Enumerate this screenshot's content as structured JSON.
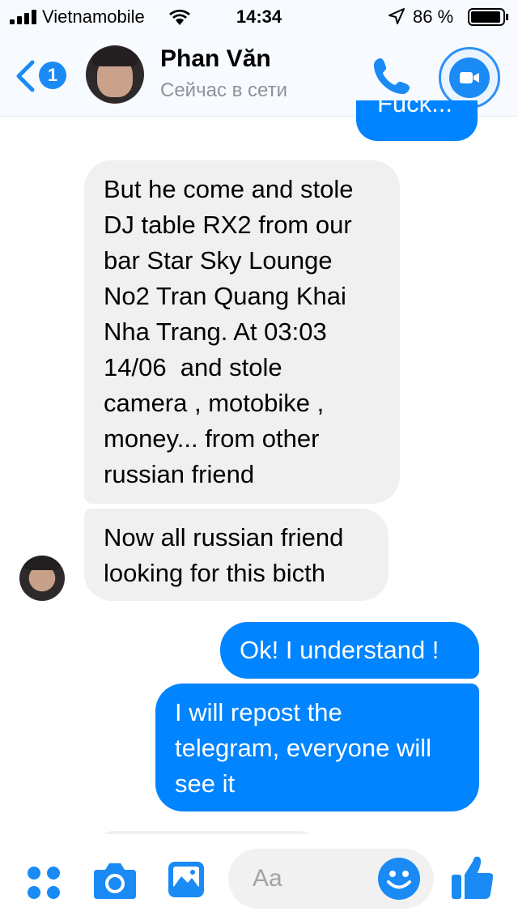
{
  "status_bar": {
    "carrier": "Vietnamobile",
    "time": "14:34",
    "battery": "86 %",
    "icons": [
      "signal-icon",
      "wifi-icon",
      "location-arrow-icon",
      "battery-icon"
    ]
  },
  "header": {
    "back_badge": "1",
    "contact_name": "Phan Văn",
    "contact_status": "Сейчас в сети",
    "icons": [
      "back-chevron-icon",
      "phone-icon",
      "video-camera-icon"
    ]
  },
  "messages": [
    {
      "from": "me",
      "text": "Fuck..."
    },
    {
      "from": "contact",
      "text": "But he come and stole\nDJ table RX2 from our\nbar Star Sky Lounge\nNo2 Tran Quang Khai\nNha Trang. At 03:03\n14/06  and stole\ncamera , motobike ,\nmoney... from other\nrussian friend"
    },
    {
      "from": "contact",
      "text": "Now all russian friend\nlooking for this bicth"
    },
    {
      "from": "me",
      "text": "Ok! I understand !"
    },
    {
      "from": "me",
      "text": "I will repost the\ntelegram, everyone will\nsee it"
    }
  ],
  "composer": {
    "placeholder": "Aa",
    "icons": [
      "apps-grid-icon",
      "camera-icon",
      "image-gallery-icon",
      "emoji-icon",
      "thumbs-up-icon"
    ]
  },
  "colors": {
    "accent": "#0084ff",
    "incoming_bubble": "#f0f0f0",
    "header_bg": "#f7fbff"
  }
}
